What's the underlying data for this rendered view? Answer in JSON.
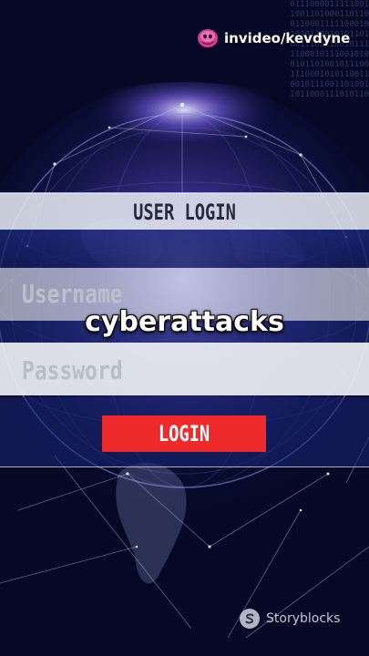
{
  "brand": {
    "label": "invideo/kevdyne",
    "logo_icon": "invideo-logo-icon",
    "logo_color": "#d63b8f"
  },
  "login_panel": {
    "title": "USER LOGIN",
    "username_placeholder": "Username",
    "password_placeholder": "Password",
    "login_button_label": "LOGIN",
    "button_color": "#ef2a2a"
  },
  "caption": "cyberattacks",
  "watermark": {
    "label": "Storyblocks",
    "icon": "storyblocks-logo-icon"
  },
  "background": {
    "description_icon": "globe-network-icon",
    "binary_text": "0111000011111001\n1001101000110110\n0110001111100010\n1010110010101101\n0011100110010111\n1100010111001010\n0101101001011100\n1110001010110011\n0010111001101001\n1011000111010110"
  },
  "colors": {
    "background": "#060b2a",
    "globe_glow": "#8f7cff",
    "panel_fill": "#e4e8f0"
  }
}
